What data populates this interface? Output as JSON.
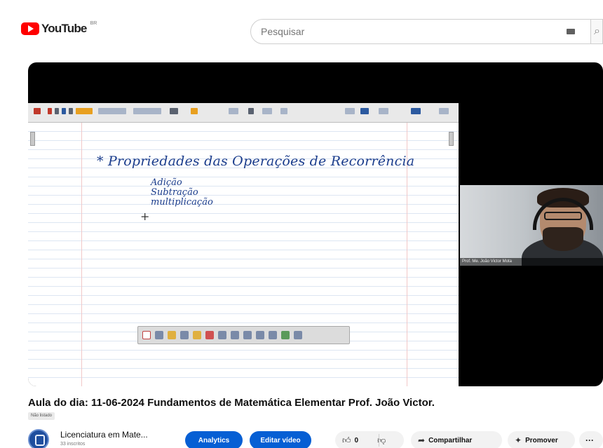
{
  "header": {
    "logo_text": "YouTube",
    "logo_country": "BR",
    "search_placeholder": "Pesquisar",
    "search_button_icon": "search-icon"
  },
  "player": {
    "board": {
      "heading": "* Propriedades das Operações de Recorrência",
      "items": [
        "Adição",
        "Subtração",
        "multiplicação"
      ],
      "cursor": "+"
    },
    "webcam": {
      "label": "Prof. Me. João Victor Mota"
    }
  },
  "video": {
    "title": "Aula do dia: 11-06-2024 Fundamentos de Matemática Elementar Prof. João Victor.",
    "visibility": "Não listado"
  },
  "channel": {
    "name": "Licenciatura em Mate...",
    "subscribers": "33 inscritos"
  },
  "actions": {
    "analytics_label": "Analytics",
    "edit_label": "Editar vídeo",
    "like_count": "0",
    "share_label": "Compartilhar",
    "promote_label": "Promover",
    "more_label": "···"
  },
  "colors": {
    "brand_red": "#ff0000",
    "accent_blue": "#065fd4",
    "ink_blue": "#1a3c8c"
  }
}
